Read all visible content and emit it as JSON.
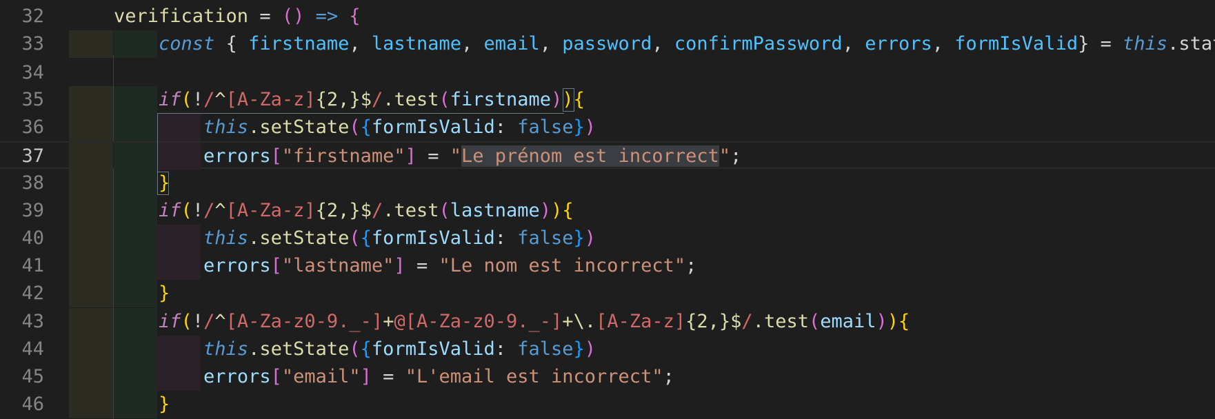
{
  "editor": {
    "first_line": 32,
    "current_line": 37,
    "lines": [
      {
        "num": "32",
        "tokens": [
          {
            "t": "verification",
            "c": "fn"
          },
          {
            "t": " = ",
            "c": "op"
          },
          {
            "t": "()",
            "c": "b2"
          },
          {
            "t": " ",
            "c": "op"
          },
          {
            "t": "=>",
            "c": "arrow"
          },
          {
            "t": " ",
            "c": "op"
          },
          {
            "t": "{",
            "c": "b2"
          }
        ]
      },
      {
        "num": "33",
        "tokens": [
          {
            "t": "    ",
            "c": "op"
          },
          {
            "t": "const",
            "c": "st"
          },
          {
            "t": " { ",
            "c": "pl"
          },
          {
            "t": "firstname",
            "c": "var"
          },
          {
            "t": ", ",
            "c": "pl"
          },
          {
            "t": "lastname",
            "c": "var"
          },
          {
            "t": ", ",
            "c": "pl"
          },
          {
            "t": "email",
            "c": "var"
          },
          {
            "t": ", ",
            "c": "pl"
          },
          {
            "t": "password",
            "c": "var"
          },
          {
            "t": ", ",
            "c": "pl"
          },
          {
            "t": "confirmPassword",
            "c": "var"
          },
          {
            "t": ", ",
            "c": "pl"
          },
          {
            "t": "errors",
            "c": "var"
          },
          {
            "t": ", ",
            "c": "pl"
          },
          {
            "t": "formIsValid",
            "c": "var"
          },
          {
            "t": "} = ",
            "c": "pl"
          },
          {
            "t": "this",
            "c": "st"
          },
          {
            "t": ".state",
            "c": "pl"
          }
        ]
      },
      {
        "num": "34",
        "tokens": []
      },
      {
        "num": "35",
        "tokens": [
          {
            "t": "    ",
            "c": "op"
          },
          {
            "t": "if",
            "c": "kw"
          },
          {
            "t": "(",
            "c": "b1"
          },
          {
            "t": "!",
            "c": "pl"
          },
          {
            "t": "/",
            "c": "re"
          },
          {
            "t": "^",
            "c": "re2"
          },
          {
            "t": "[A-Za-z]",
            "c": "re"
          },
          {
            "t": "{2,}",
            "c": "re2"
          },
          {
            "t": "$",
            "c": "re2"
          },
          {
            "t": "/",
            "c": "re"
          },
          {
            "t": ".test",
            "c": "fn"
          },
          {
            "t": "(",
            "c": "b2"
          },
          {
            "t": "firstname",
            "c": "prop"
          },
          {
            "t": ")",
            "c": "b2"
          },
          {
            "t": ")",
            "c": "b1"
          },
          {
            "t": "{",
            "c": "b1"
          }
        ]
      },
      {
        "num": "36",
        "tokens": [
          {
            "t": "        ",
            "c": "op"
          },
          {
            "t": "this",
            "c": "st"
          },
          {
            "t": ".setState",
            "c": "fn"
          },
          {
            "t": "(",
            "c": "b2"
          },
          {
            "t": "{",
            "c": "b3"
          },
          {
            "t": "formIsValid",
            "c": "prop"
          },
          {
            "t": ": ",
            "c": "pl"
          },
          {
            "t": "false",
            "c": "bool"
          },
          {
            "t": "}",
            "c": "b3"
          },
          {
            "t": ")",
            "c": "b2"
          }
        ]
      },
      {
        "num": "37",
        "tokens": [
          {
            "t": "        ",
            "c": "op"
          },
          {
            "t": "errors",
            "c": "prop"
          },
          {
            "t": "[",
            "c": "b2"
          },
          {
            "t": "\"firstname\"",
            "c": "str"
          },
          {
            "t": "]",
            "c": "b2"
          },
          {
            "t": " = ",
            "c": "pl"
          },
          {
            "t": "\"",
            "c": "str"
          },
          {
            "t": "Le prénom est incorrect",
            "c": "str sel"
          },
          {
            "t": "\"",
            "c": "str"
          },
          {
            "t": ";",
            "c": "pl"
          }
        ]
      },
      {
        "num": "38",
        "tokens": [
          {
            "t": "    ",
            "c": "op"
          },
          {
            "t": "}",
            "c": "b1"
          }
        ]
      },
      {
        "num": "39",
        "tokens": [
          {
            "t": "    ",
            "c": "op"
          },
          {
            "t": "if",
            "c": "kw"
          },
          {
            "t": "(",
            "c": "b1"
          },
          {
            "t": "!",
            "c": "pl"
          },
          {
            "t": "/",
            "c": "re"
          },
          {
            "t": "^",
            "c": "re2"
          },
          {
            "t": "[A-Za-z]",
            "c": "re"
          },
          {
            "t": "{2,}",
            "c": "re2"
          },
          {
            "t": "$",
            "c": "re2"
          },
          {
            "t": "/",
            "c": "re"
          },
          {
            "t": ".test",
            "c": "fn"
          },
          {
            "t": "(",
            "c": "b2"
          },
          {
            "t": "lastname",
            "c": "prop"
          },
          {
            "t": ")",
            "c": "b2"
          },
          {
            "t": ")",
            "c": "b1"
          },
          {
            "t": "{",
            "c": "b1"
          }
        ]
      },
      {
        "num": "40",
        "tokens": [
          {
            "t": "        ",
            "c": "op"
          },
          {
            "t": "this",
            "c": "st"
          },
          {
            "t": ".setState",
            "c": "fn"
          },
          {
            "t": "(",
            "c": "b2"
          },
          {
            "t": "{",
            "c": "b3"
          },
          {
            "t": "formIsValid",
            "c": "prop"
          },
          {
            "t": ": ",
            "c": "pl"
          },
          {
            "t": "false",
            "c": "bool"
          },
          {
            "t": "}",
            "c": "b3"
          },
          {
            "t": ")",
            "c": "b2"
          }
        ]
      },
      {
        "num": "41",
        "tokens": [
          {
            "t": "        ",
            "c": "op"
          },
          {
            "t": "errors",
            "c": "prop"
          },
          {
            "t": "[",
            "c": "b2"
          },
          {
            "t": "\"lastname\"",
            "c": "str"
          },
          {
            "t": "]",
            "c": "b2"
          },
          {
            "t": " = ",
            "c": "pl"
          },
          {
            "t": "\"Le nom est incorrect\"",
            "c": "str"
          },
          {
            "t": ";",
            "c": "pl"
          }
        ]
      },
      {
        "num": "42",
        "tokens": [
          {
            "t": "    ",
            "c": "op"
          },
          {
            "t": "}",
            "c": "b1"
          }
        ]
      },
      {
        "num": "43",
        "tokens": [
          {
            "t": "    ",
            "c": "op"
          },
          {
            "t": "if",
            "c": "kw"
          },
          {
            "t": "(",
            "c": "b1"
          },
          {
            "t": "!",
            "c": "pl"
          },
          {
            "t": "/",
            "c": "re"
          },
          {
            "t": "^",
            "c": "re2"
          },
          {
            "t": "[A-Za-z0-9._-]",
            "c": "re"
          },
          {
            "t": "+",
            "c": "re2"
          },
          {
            "t": "@",
            "c": "re"
          },
          {
            "t": "[A-Za-z0-9._-]",
            "c": "re"
          },
          {
            "t": "+",
            "c": "re2"
          },
          {
            "t": "\\.",
            "c": "re2"
          },
          {
            "t": "[A-Za-z]",
            "c": "re"
          },
          {
            "t": "{2,}",
            "c": "re2"
          },
          {
            "t": "$",
            "c": "re2"
          },
          {
            "t": "/",
            "c": "re"
          },
          {
            "t": ".test",
            "c": "fn"
          },
          {
            "t": "(",
            "c": "b2"
          },
          {
            "t": "email",
            "c": "prop"
          },
          {
            "t": ")",
            "c": "b2"
          },
          {
            "t": ")",
            "c": "b1"
          },
          {
            "t": "{",
            "c": "b1"
          }
        ]
      },
      {
        "num": "44",
        "tokens": [
          {
            "t": "        ",
            "c": "op"
          },
          {
            "t": "this",
            "c": "st"
          },
          {
            "t": ".setState",
            "c": "fn"
          },
          {
            "t": "(",
            "c": "b2"
          },
          {
            "t": "{",
            "c": "b3"
          },
          {
            "t": "formIsValid",
            "c": "prop"
          },
          {
            "t": ": ",
            "c": "pl"
          },
          {
            "t": "false",
            "c": "bool"
          },
          {
            "t": "}",
            "c": "b3"
          },
          {
            "t": ")",
            "c": "b2"
          }
        ]
      },
      {
        "num": "45",
        "tokens": [
          {
            "t": "        ",
            "c": "op"
          },
          {
            "t": "errors",
            "c": "prop"
          },
          {
            "t": "[",
            "c": "b2"
          },
          {
            "t": "\"email\"",
            "c": "str"
          },
          {
            "t": "]",
            "c": "b2"
          },
          {
            "t": " = ",
            "c": "pl"
          },
          {
            "t": "\"L'email est incorrect\"",
            "c": "str"
          },
          {
            "t": ";",
            "c": "pl"
          }
        ]
      },
      {
        "num": "46",
        "tokens": [
          {
            "t": "    ",
            "c": "op"
          },
          {
            "t": "}",
            "c": "b1"
          }
        ]
      }
    ]
  },
  "colors": {
    "background": "#1e1e1e",
    "line_number": "#858585",
    "line_number_active": "#c6c6c6"
  }
}
